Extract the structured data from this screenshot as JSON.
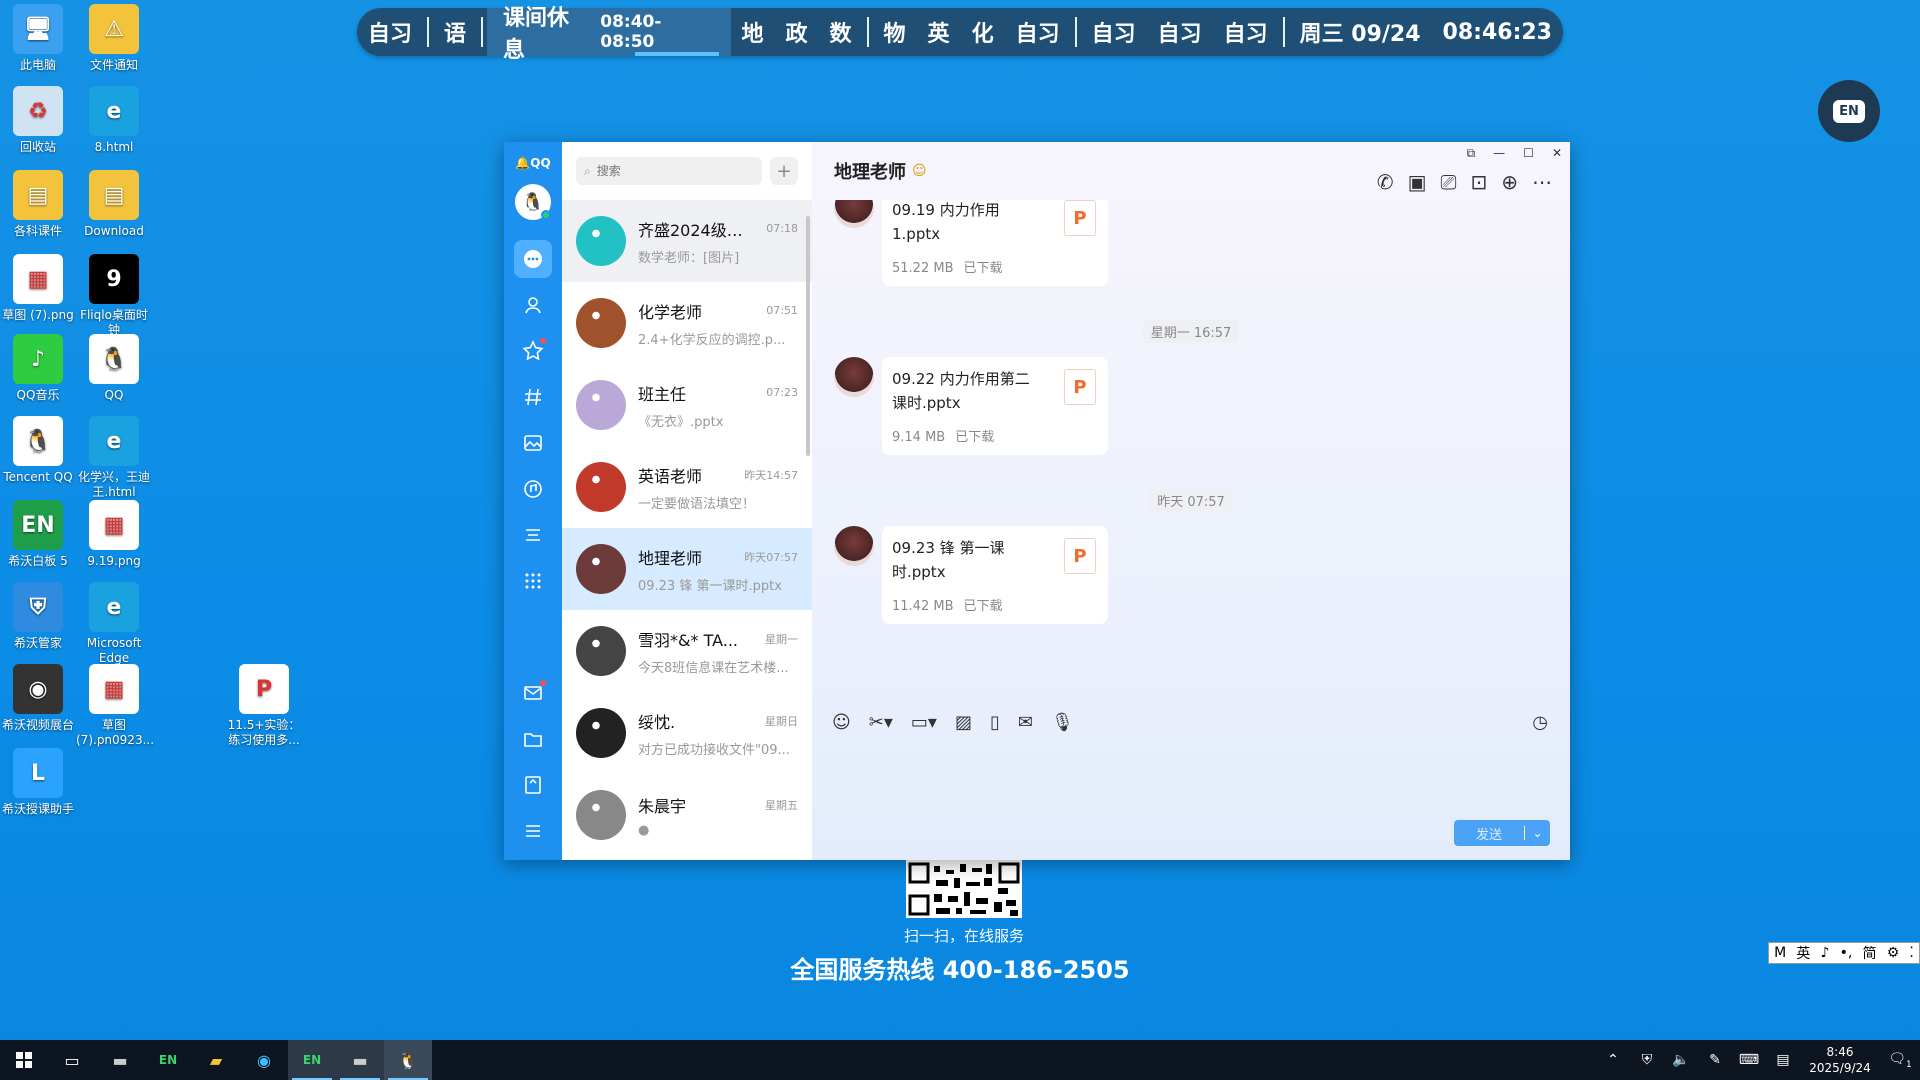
{
  "schedule": {
    "items": [
      "自习",
      "语",
      "课间休息",
      "地",
      "政",
      "数",
      "物",
      "英",
      "化",
      "自习",
      "自习",
      "自习",
      "自习"
    ],
    "current_period": "08:40-08:50",
    "date": "周三 09/24",
    "time": "08:46:23"
  },
  "desktop": {
    "icons": [
      {
        "label": "此电脑",
        "icon": "computer-icon"
      },
      {
        "label": "文件通知",
        "icon": "folder-warning-icon"
      },
      {
        "label": "回收站",
        "icon": "recycle-bin-icon"
      },
      {
        "label": "8.html",
        "icon": "edge-icon"
      },
      {
        "label": "各科课件",
        "icon": "folder-icon"
      },
      {
        "label": "Download",
        "icon": "folder-icon"
      },
      {
        "label": "草图 (7).png",
        "icon": "image-icon"
      },
      {
        "label": "Fliqlo桌面时钟",
        "icon": "clock-icon"
      },
      {
        "label": "QQ音乐",
        "icon": "qq-music-icon"
      },
      {
        "label": "QQ",
        "icon": "qq-icon"
      },
      {
        "label": "Tencent QQ",
        "icon": "qq-icon"
      },
      {
        "label": "化学兴，王迪王.html",
        "icon": "edge-icon"
      },
      {
        "label": "希沃白板 5",
        "icon": "seewo-board-icon"
      },
      {
        "label": "9.19.png",
        "icon": "image-icon"
      },
      {
        "label": "希沃管家",
        "icon": "shield-icon"
      },
      {
        "label": "Microsoft Edge",
        "icon": "edge-icon"
      },
      {
        "label": "希沃视频展台",
        "icon": "camera-icon"
      },
      {
        "label": "草图 (7).pn0923...",
        "icon": "image-icon"
      },
      {
        "label": "11.5+实验：练习使用多...",
        "icon": "pptx-icon"
      },
      {
        "label": "希沃授课助手",
        "icon": "link-icon"
      }
    ],
    "en_badge": "EN",
    "qr_caption": "扫一扫，在线服务",
    "hotline": "全国服务热线 400-186-2505",
    "ime": [
      "M",
      "英",
      "♪",
      "•,",
      "简",
      "⚙",
      "⁚"
    ]
  },
  "qq": {
    "logo": "QQ",
    "search": {
      "placeholder": "搜索"
    },
    "conversations": [
      {
        "name": "齐盛2024级8...",
        "time": "07:18",
        "preview": "数学老师：[图片]",
        "color": "#22c1c3",
        "state": "grey"
      },
      {
        "name": "化学老师",
        "time": "07:51",
        "preview": "2.4+化学反应的调控.p...",
        "color": "#a0522d",
        "state": ""
      },
      {
        "name": "班主任",
        "time": "07:23",
        "preview": "《无衣》.pptx",
        "color": "#b9a8d8",
        "state": ""
      },
      {
        "name": "英语老师",
        "time": "昨天14:57",
        "preview": "一定要做语法填空！",
        "color": "#c0392b",
        "state": ""
      },
      {
        "name": "地理老师",
        "time": "昨天07:57",
        "preview": "09.23 锋 第一课时.pptx",
        "color": "#6d3a3a",
        "state": "sel"
      },
      {
        "name": "雪羽*&* TA...",
        "time": "星期一",
        "preview": "今天8班信息课在艺术楼...",
        "color": "#444",
        "state": ""
      },
      {
        "name": "绥忱.",
        "time": "星期日",
        "preview": "对方已成功接收文件\"09...",
        "color": "#222",
        "state": ""
      },
      {
        "name": "朱晨宇",
        "time": "星期五",
        "preview": "●",
        "color": "#888",
        "state": ""
      }
    ],
    "chat": {
      "title": "地理老师",
      "messages": [
        {
          "type": "file",
          "name": "09.19 内力作用1.pptx",
          "size": "51.22 MB",
          "status": "已下载"
        },
        {
          "type": "stamp",
          "text": "星期一 16:57"
        },
        {
          "type": "file",
          "name": "09.22 内力作用第二课时.pptx",
          "size": "9.14 MB",
          "status": "已下载"
        },
        {
          "type": "stamp",
          "text": "昨天 07:57"
        },
        {
          "type": "file",
          "name": "09.23 锋 第一课时.pptx",
          "size": "11.42 MB",
          "status": "已下载"
        }
      ],
      "send_label": "发送"
    }
  },
  "taskbar": {
    "clock_time": "8:46",
    "clock_date": "2025/9/24",
    "notif_count": "1"
  }
}
